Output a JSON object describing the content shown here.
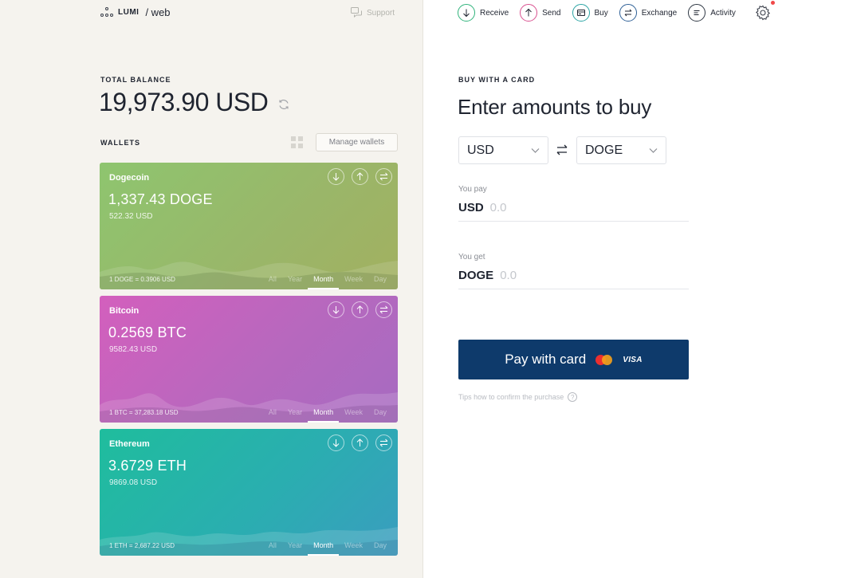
{
  "brand": {
    "name": "LUMI",
    "section": "/ web"
  },
  "support": {
    "label": "Support"
  },
  "balance": {
    "label": "TOTAL BALANCE",
    "value": "19,973.90 USD"
  },
  "wallets": {
    "label": "WALLETS",
    "manage_label": "Manage wallets",
    "periods": [
      "All",
      "Year",
      "Month",
      "Week",
      "Day"
    ],
    "active_period": "Month",
    "cards": [
      {
        "name": "Dogecoin",
        "amount": "1,337.43 DOGE",
        "usd": "522.32 USD",
        "rate": "1 DOGE = 0.3906 USD"
      },
      {
        "name": "Bitcoin",
        "amount": "0.2569 BTC",
        "usd": "9582.43 USD",
        "rate": "1 BTC = 37,283.18 USD"
      },
      {
        "name": "Ethereum",
        "amount": "3.6729 ETH",
        "usd": "9869.08 USD",
        "rate": "1 ETH = 2,687.22 USD"
      }
    ]
  },
  "nav": {
    "items": [
      {
        "label": "Receive",
        "icon": "arrow-down-icon",
        "color": "#2fb37b"
      },
      {
        "label": "Send",
        "icon": "arrow-up-icon",
        "color": "#d9508f"
      },
      {
        "label": "Buy",
        "icon": "card-icon",
        "color": "#2aa4a4"
      },
      {
        "label": "Exchange",
        "icon": "swap-icon",
        "color": "#2d5f96"
      },
      {
        "label": "Activity",
        "icon": "list-icon",
        "color": "#2d3642"
      }
    ],
    "notification_color": "#f04848"
  },
  "buy": {
    "label": "BUY WITH A CARD",
    "title": "Enter amounts to buy",
    "from_currency": "USD",
    "to_currency": "DOGE",
    "pay_label": "You pay",
    "pay_currency": "USD",
    "pay_placeholder": "0.0",
    "get_label": "You get",
    "get_currency": "DOGE",
    "get_placeholder": "0.0",
    "button_label": "Pay with card",
    "visa_label": "VISA",
    "tips": "Tips how to confirm the purchase",
    "tips_icon": "?"
  },
  "colors": {
    "button": "#0e3a6b",
    "accent_dark": "#1f2430"
  }
}
